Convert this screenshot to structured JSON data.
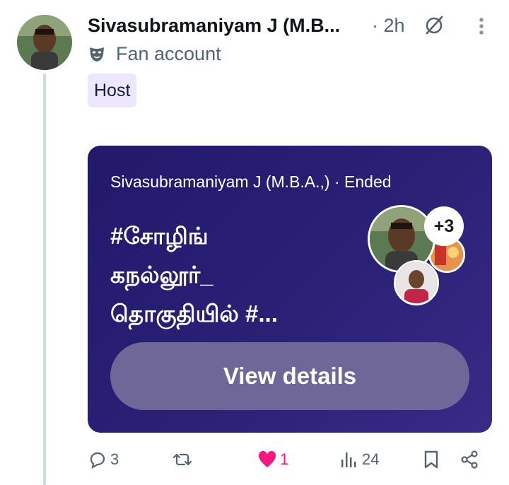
{
  "post": {
    "author_name": "Sivasubramaniyam J (M.B...",
    "time": "· 2h",
    "label": "Fan account",
    "host_badge": "Host"
  },
  "space_card": {
    "meta": "Sivasubramaniyam J (M.B.A.,) · Ended",
    "title_lines": [
      "#சோழிங்",
      "கநல்லூர்_",
      "தொகுதியில் #..."
    ],
    "extra_speakers": "+3",
    "button_label": "View details"
  },
  "actions": {
    "replies": "3",
    "reposts": "",
    "likes": "1",
    "views": "24"
  },
  "colors": {
    "card_bg": "#22196b",
    "like": "#f91880",
    "host_badge_bg": "#ece7fd"
  },
  "icons": [
    "mask-icon",
    "grok-icon",
    "more-icon",
    "reply-icon",
    "repost-icon",
    "heart-icon",
    "views-icon",
    "bookmark-icon",
    "share-icon"
  ]
}
